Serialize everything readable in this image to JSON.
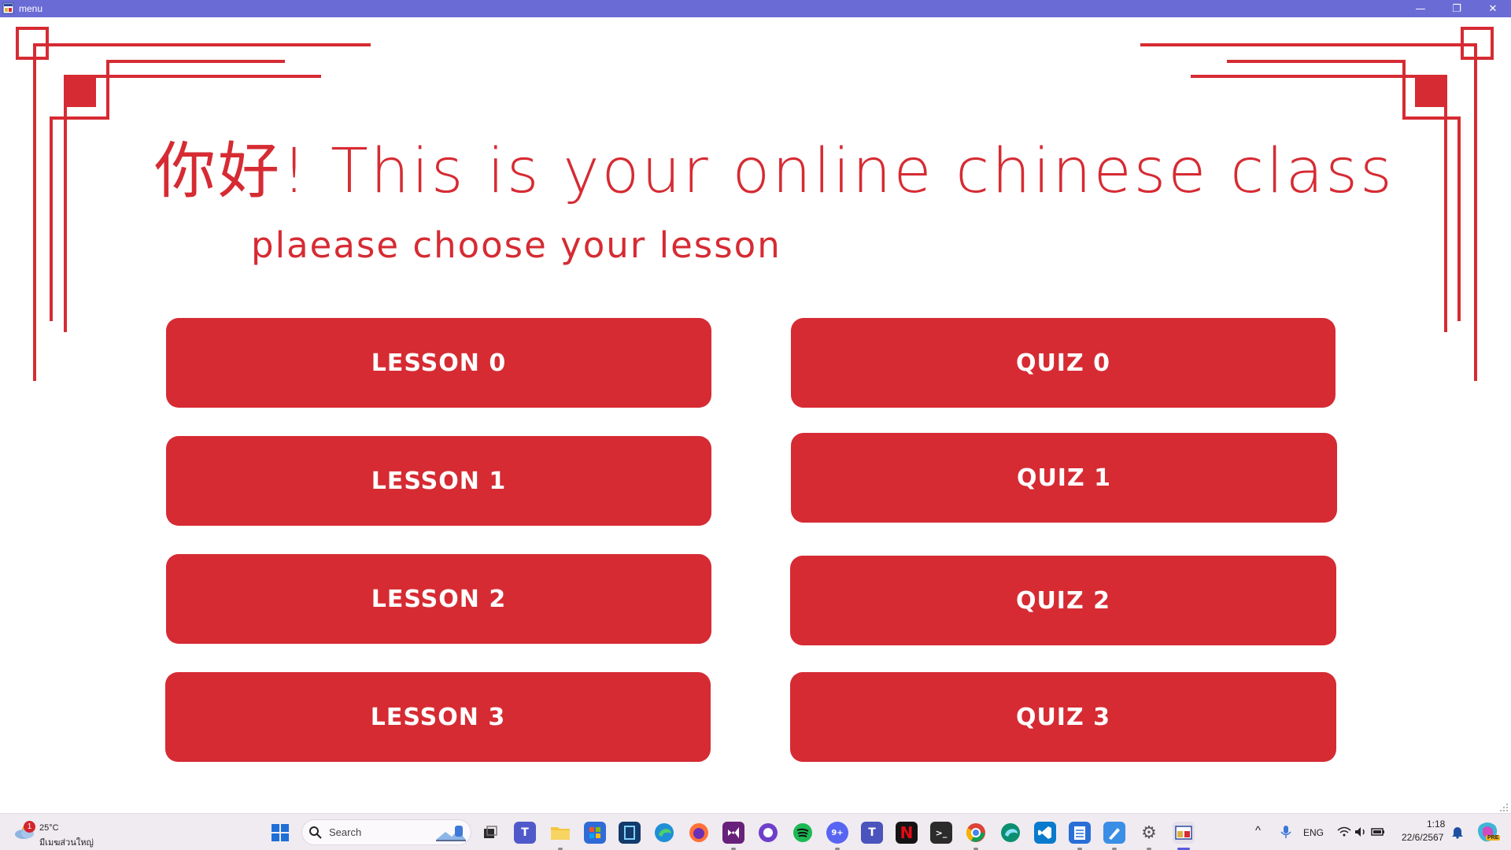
{
  "window": {
    "title": "menu",
    "minimize_glyph": "—",
    "restore_glyph": "❐",
    "close_glyph": "✕"
  },
  "page": {
    "heading": "你好!   This is your online chinese class",
    "subheading": "plaease choose your lesson"
  },
  "lessons": [
    {
      "label": "LESSON 0"
    },
    {
      "label": "LESSON 1"
    },
    {
      "label": "LESSON 2"
    },
    {
      "label": "LESSON 3"
    }
  ],
  "quizzes": [
    {
      "label": "QUIZ 0"
    },
    {
      "label": "QUIZ 1"
    },
    {
      "label": "QUIZ 2"
    },
    {
      "label": "QUIZ 3"
    }
  ],
  "colors": {
    "accent_red": "#d62b33",
    "titlebar": "#6b6bd6",
    "taskbar": "#f0ebf0"
  },
  "taskbar": {
    "weather": {
      "badge": "1",
      "temperature": "25°C",
      "location": "มีเมฆส่วนใหญ่"
    },
    "search": {
      "label": "Search"
    },
    "apps": [
      {
        "name": "start-icon"
      },
      {
        "name": "task-view-icon"
      },
      {
        "name": "teams-icon",
        "glyph": "T"
      },
      {
        "name": "file-explorer-icon"
      },
      {
        "name": "microsoft-store-icon"
      },
      {
        "name": "notepad-app-icon"
      },
      {
        "name": "edge-icon"
      },
      {
        "name": "firefox-icon"
      },
      {
        "name": "visual-studio-icon"
      },
      {
        "name": "github-desktop-icon"
      },
      {
        "name": "spotify-icon"
      },
      {
        "name": "discord-icon",
        "glyph": "9+"
      },
      {
        "name": "teams-work-icon",
        "glyph": "T"
      },
      {
        "name": "netflix-icon",
        "glyph": "N"
      },
      {
        "name": "terminal-icon",
        "glyph": ">_"
      },
      {
        "name": "chrome-icon"
      },
      {
        "name": "edge-dev-icon"
      },
      {
        "name": "vscode-icon"
      },
      {
        "name": "notepad-icon"
      },
      {
        "name": "paint-icon"
      },
      {
        "name": "settings-icon",
        "glyph": "⚙"
      },
      {
        "name": "menu-app-icon"
      }
    ],
    "tray": {
      "chevron": "^",
      "language": "ENG",
      "time": "1:18",
      "date": "22/6/2567",
      "copilot_badge": "PRE"
    }
  }
}
